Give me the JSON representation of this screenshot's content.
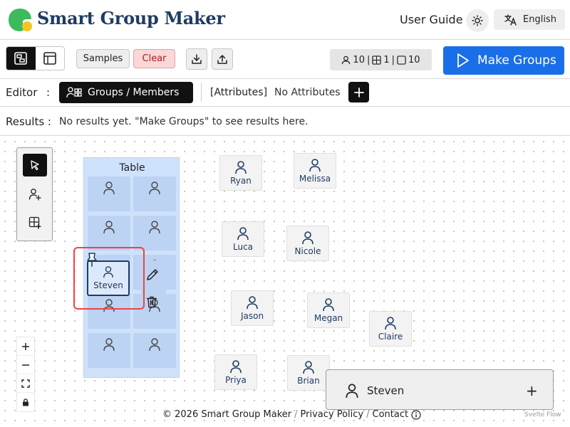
{
  "header": {
    "title": "Smart Group Maker",
    "user_guide": "User Guide",
    "language": "English",
    "icons": {
      "logo": "app-logo-icon",
      "theme": "sun-icon",
      "language": "translate-icon"
    }
  },
  "toolbar": {
    "samples_label": "Samples",
    "clear_label": "Clear",
    "counts": {
      "members": "10",
      "groups": "1",
      "seats": "10"
    },
    "make_groups_label": "Make Groups",
    "colors": {
      "primary": "#1a6fe8",
      "clear_bg": "#fbd7d7",
      "clear_text": "#a32222"
    }
  },
  "editor": {
    "label": "Editor",
    "colon": ":",
    "active_tab": "Groups / Members",
    "attributes_label": "[Attributes]",
    "no_attributes": "No Attributes"
  },
  "results": {
    "label": "Results :",
    "text": "No results yet. \"Make Groups\" to see results here."
  },
  "canvas": {
    "group": {
      "label": "Table"
    },
    "selected_member": "Steven",
    "members": [
      "Ryan",
      "Melissa",
      "Luca",
      "Nicole",
      "Jason",
      "Megan",
      "Claire",
      "Priya",
      "Brian"
    ]
  },
  "detail": {
    "name": "Steven",
    "add": "+"
  },
  "footer": {
    "copyright": "© 2026 Smart Group Maker",
    "sep": "/",
    "privacy": "Privacy Policy",
    "contact": "Contact",
    "svelte_flow": "Svelte Flow"
  }
}
